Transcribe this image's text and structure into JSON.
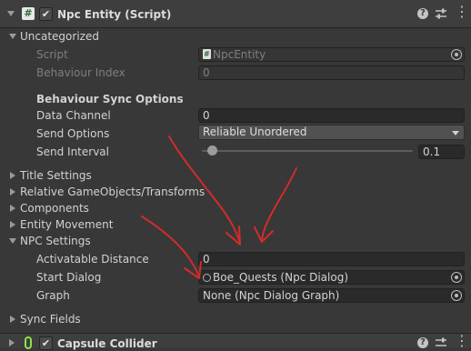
{
  "component_header": {
    "title": "Npc Entity (Script)",
    "enabled": "✔"
  },
  "uncategorized": {
    "title": "Uncategorized",
    "script": {
      "label": "Script",
      "value": "NpcEntity"
    },
    "behaviour_index": {
      "label": "Behaviour Index",
      "value": "0"
    },
    "sync_options": {
      "title": "Behaviour Sync Options",
      "data_channel": {
        "label": "Data Channel",
        "value": "0"
      },
      "send_options": {
        "label": "Send Options",
        "value": "Reliable Unordered"
      },
      "send_interval": {
        "label": "Send Interval",
        "value": "0.1",
        "slider_fraction": 0.01
      }
    }
  },
  "collapsed_sections": [
    "Title Settings",
    "Relative GameObjects/Transforms",
    "Components",
    "Entity Movement"
  ],
  "npc_settings": {
    "title": "NPC Settings",
    "activatable_distance": {
      "label": "Activatable Distance",
      "value": "0"
    },
    "start_dialog": {
      "label": "Start Dialog",
      "value": "Boe_Quests (Npc Dialog)"
    },
    "graph": {
      "label": "Graph",
      "value": "None (Npc Dialog Graph)"
    }
  },
  "sync_fields": {
    "title": "Sync Fields"
  },
  "next_component": {
    "title": "Capsule Collider",
    "enabled": "✔"
  },
  "colors": {
    "annotation": "#d32b2b",
    "background": "#383838",
    "header": "#3e3e3e"
  }
}
